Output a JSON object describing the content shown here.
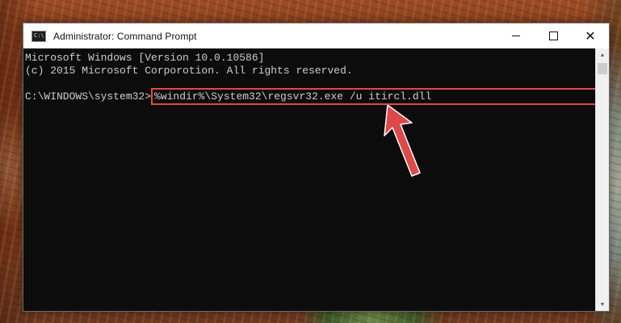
{
  "window": {
    "title": "Administrator: Command Prompt",
    "icon_glyph": "C:\\",
    "controls": {
      "minimize": "minimize-icon",
      "maximize": "maximize-icon",
      "close_glyph": "✕"
    }
  },
  "console": {
    "lines": [
      "Microsoft Windows [Version 10.0.10586]",
      "(c) 2015 Microsoft Corporotion. All rights reserved."
    ],
    "prompt": "C:\\WINDOWS\\system32>",
    "command": "%windir%\\System32\\regsvr32.exe /u itircl.dll"
  },
  "scrollbar": {
    "up_glyph": "▲",
    "down_glyph": "▼"
  },
  "annotation": {
    "highlight_color": "#e04848",
    "arrow_color": "#e04848"
  }
}
